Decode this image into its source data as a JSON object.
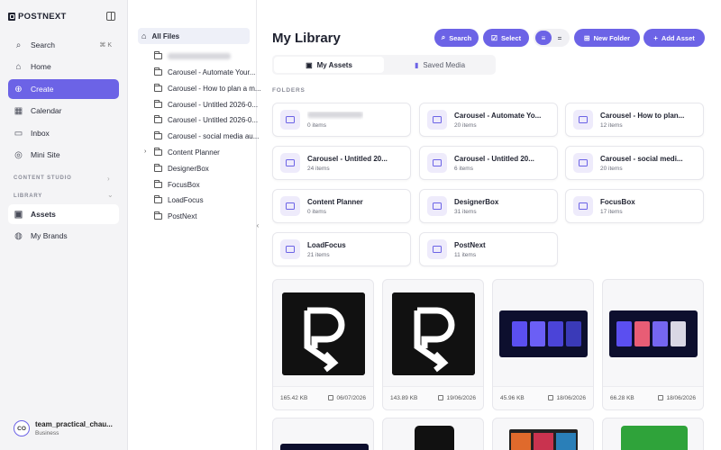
{
  "brand": "POSTNEXT",
  "sidebar": {
    "search_label": "Search",
    "search_shortcut": "⌘ K",
    "items": [
      {
        "label": "Home"
      },
      {
        "label": "Create"
      },
      {
        "label": "Calendar"
      },
      {
        "label": "Inbox"
      },
      {
        "label": "Mini Site"
      }
    ],
    "section_content_studio": "CONTENT STUDIO",
    "section_library": "LIBRARY",
    "library_items": [
      {
        "label": "Assets"
      },
      {
        "label": "My Brands"
      }
    ],
    "user": {
      "initials": "CO",
      "name": "team_practical_chau...",
      "plan": "Business"
    }
  },
  "tree": {
    "root": "All Files",
    "items": [
      "Carousel - Automate Your...",
      "Carousel - How to plan a m...",
      "Carousel - Untitled 2026-0...",
      "Carousel - Untitled 2026-0...",
      "Carousel - social media au...",
      "Content Planner",
      "DesignerBox",
      "FocusBox",
      "LoadFocus",
      "PostNext"
    ]
  },
  "main": {
    "title": "My Library",
    "buttons": {
      "search": "Search",
      "select": "Select",
      "new_folder": "New Folder",
      "add_asset": "Add Asset"
    },
    "tabs": {
      "my_assets": "My Assets",
      "saved_media": "Saved Media"
    },
    "folders_heading": "FOLDERS",
    "folders": [
      {
        "name": "",
        "count": "0 items"
      },
      {
        "name": "Carousel - Automate Yo...",
        "count": "20 items"
      },
      {
        "name": "Carousel - How to plan...",
        "count": "12 items"
      },
      {
        "name": "Carousel - Untitled 20...",
        "count": "24 items"
      },
      {
        "name": "Carousel - Untitled 20...",
        "count": "6 items"
      },
      {
        "name": "Carousel - social medi...",
        "count": "20 items"
      },
      {
        "name": "Content Planner",
        "count": "0 items"
      },
      {
        "name": "DesignerBox",
        "count": "31 items"
      },
      {
        "name": "FocusBox",
        "count": "17 items"
      },
      {
        "name": "LoadFocus",
        "count": "21 items"
      },
      {
        "name": "PostNext",
        "count": "11 items"
      }
    ],
    "assets": [
      {
        "size": "165.42 KB",
        "date": "06/07/2026"
      },
      {
        "size": "143.89 KB",
        "date": "19/06/2026"
      },
      {
        "size": "45.96 KB",
        "date": "18/06/2026"
      },
      {
        "size": "66.28 KB",
        "date": "18/06/2026"
      }
    ]
  },
  "colors": {
    "accent": "#6c63e6",
    "folder_bg": "#eeebfb"
  }
}
